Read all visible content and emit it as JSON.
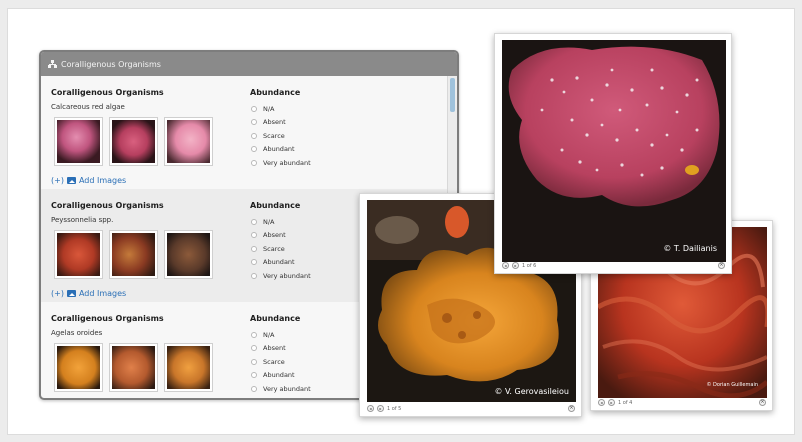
{
  "panel": {
    "title": "Coralligenous Organisms",
    "icon": "sitemap-icon"
  },
  "sections": [
    {
      "title": "Coralligenous Organisms",
      "species": "Calcareous red algae",
      "abundance_title": "Abundance",
      "options": [
        "N/A",
        "Absent",
        "Scarce",
        "Abundant",
        "Very abundant"
      ],
      "add_prefix": "(+)",
      "add_label": "Add Images"
    },
    {
      "title": "Coralligenous Organisms",
      "species": "Peyssonnelia spp.",
      "abundance_title": "Abundance",
      "options": [
        "N/A",
        "Absent",
        "Scarce",
        "Abundant",
        "Very abundant"
      ],
      "add_prefix": "(+)",
      "add_label": "Add Images"
    },
    {
      "title": "Coralligenous Organisms",
      "species": "Agelas oroides",
      "abundance_title": "Abundance",
      "options": [
        "N/A",
        "Absent",
        "Scarce",
        "Abundant",
        "Very abundant"
      ]
    }
  ],
  "photos": {
    "dailianis": {
      "credit": "© T. Dailianis",
      "counter": "1 of 6"
    },
    "gerovasileiou": {
      "credit": "© V. Gerovasileiou",
      "counter": "1 of 5"
    },
    "red": {
      "credit": "© Dorian Guillemain",
      "counter": "1 of 4"
    }
  }
}
